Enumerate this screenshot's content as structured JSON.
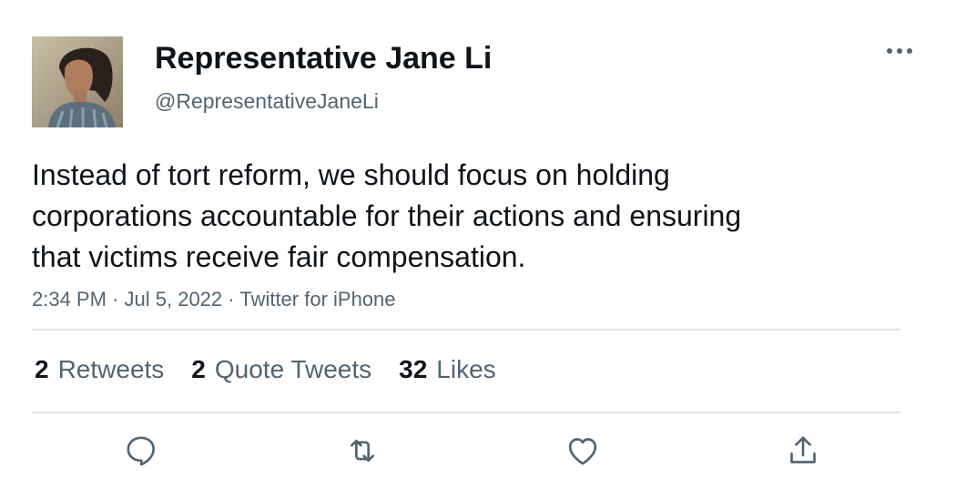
{
  "author": {
    "display_name": "Representative Jane Li",
    "handle": "@RepresentativeJaneLi",
    "avatar_icon": "profile-photo"
  },
  "tweet": {
    "text": "Instead of tort reform, we should focus on holding corporations accountable for their actions and ensuring that victims receive fair compensation.",
    "time": "2:34 PM",
    "separator": "·",
    "date": "Jul 5, 2022",
    "source": "Twitter for iPhone"
  },
  "stats": {
    "retweets_count": "2",
    "retweets_label": "Retweets",
    "quotes_count": "2",
    "quotes_label": "Quote Tweets",
    "likes_count": "32",
    "likes_label": "Likes"
  },
  "actions": [
    "reply-icon",
    "retweet-icon",
    "like-icon",
    "share-icon"
  ],
  "colors": {
    "primary_text": "#0f1419",
    "secondary_text": "#536471",
    "divider": "#dfe3e6",
    "icon": "#536471"
  }
}
